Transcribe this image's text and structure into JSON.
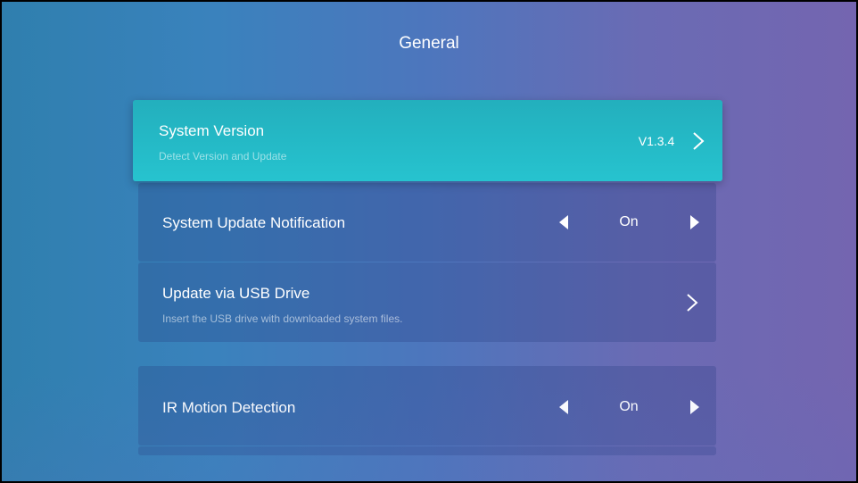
{
  "header": {
    "title": "General"
  },
  "items": [
    {
      "label": "System Version",
      "sublabel": "Detect Version and Update",
      "value": "V1.3.4",
      "control": "chevron-right",
      "focused": true
    },
    {
      "label": "System Update Notification",
      "value": "On",
      "control": "left-right-selector"
    },
    {
      "label": "Update via USB Drive",
      "sublabel": "Insert the USB drive with downloaded system files.",
      "control": "chevron-right"
    },
    {
      "label": "IR Motion Detection",
      "value": "On",
      "control": "left-right-selector"
    }
  ],
  "colors": {
    "focused_card": "#26b9c6",
    "background_left": "#2f7fae",
    "background_right": "#7465b0",
    "text": "#ffffff"
  }
}
